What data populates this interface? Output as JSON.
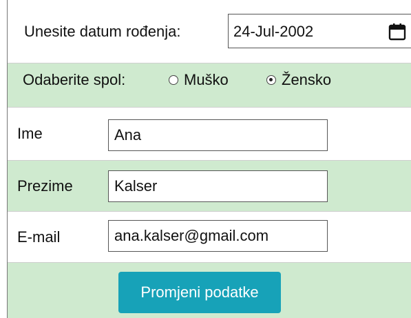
{
  "birthdate": {
    "label": "Unesite datum rođenja:",
    "value": "24-Jul-2002"
  },
  "gender": {
    "label": "Odaberite spol:",
    "options": [
      {
        "label": "Muško",
        "selected": false
      },
      {
        "label": "Žensko",
        "selected": true
      }
    ]
  },
  "fields": {
    "first_name": {
      "label": "Ime",
      "value": "Ana"
    },
    "last_name": {
      "label": "Prezime",
      "value": "Kalser"
    },
    "email": {
      "label": "E-mail",
      "value": "ana.kalser@gmail.com"
    }
  },
  "submit": {
    "label": "Promjeni podatke"
  },
  "colors": {
    "row_green": "#cfeacf",
    "button": "#17a2b8",
    "button_text": "#ffffff"
  },
  "icons": {
    "date_picker": "calendar-icon"
  }
}
